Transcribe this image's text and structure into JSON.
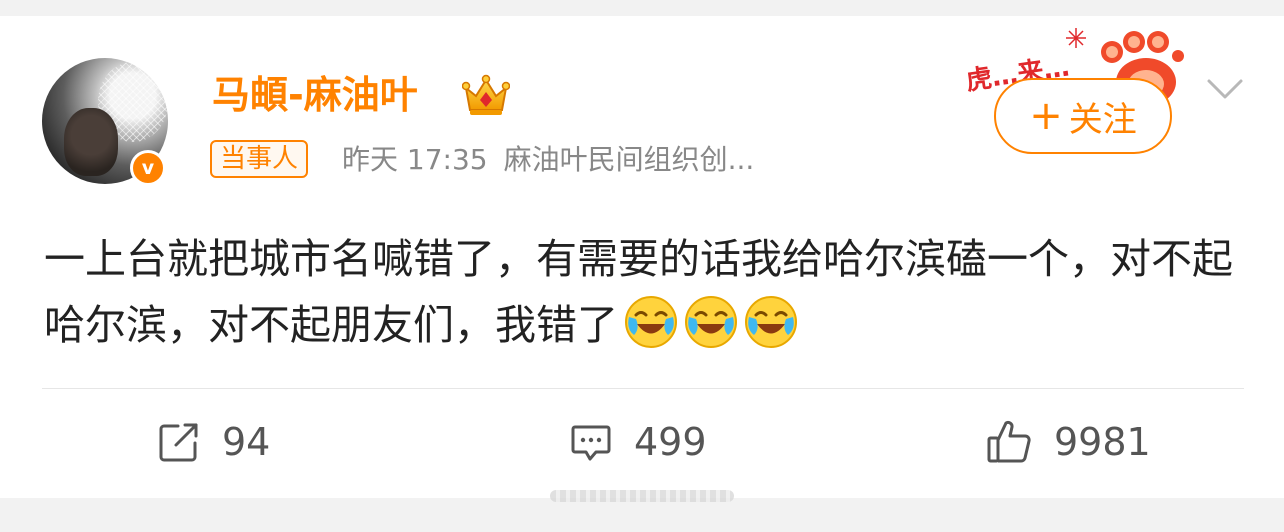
{
  "post": {
    "author": {
      "name": "马頔-麻油叶",
      "verified_icon_name": "verified-v-badge",
      "verified_letter": "v",
      "crown_icon_name": "vip-crown-icon"
    },
    "badge": "当事人",
    "time": "昨天 17:35",
    "source": "麻油叶民间组织创...",
    "follow": {
      "plus": "+",
      "label": "关注"
    },
    "decoration_text": "虎…来…",
    "content": "一上台就把城市名喊错了，有需要的话我给哈尔滨磕一个，对不起哈尔滨，对不起朋友们，我错了",
    "emojis": [
      "laugh-cry-emoji",
      "laugh-cry-emoji",
      "laugh-cry-emoji"
    ],
    "actions": {
      "share_count": "94",
      "comment_count": "499",
      "like_count": "9981"
    }
  },
  "colors": {
    "accent": "#ff8200",
    "text": "#222222",
    "meta": "#888888",
    "background": "#f2f2f2"
  }
}
